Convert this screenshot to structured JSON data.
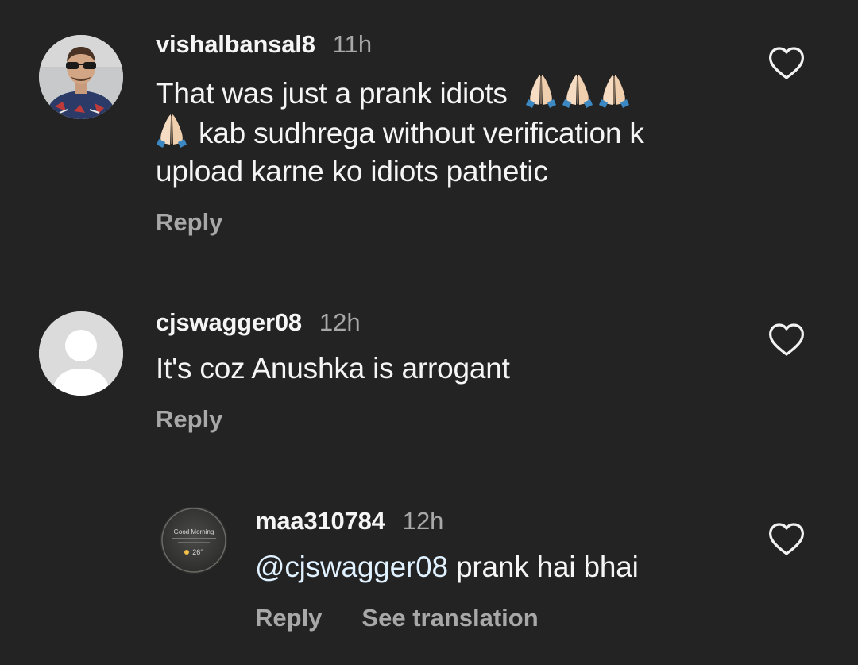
{
  "colors": {
    "background": "#232323",
    "primary_text": "#f5f5f5",
    "secondary_text": "#a8a8a8"
  },
  "comments": [
    {
      "username": "vishalbansal8",
      "time": "11h",
      "text_line1": "That was just a prank idiots",
      "text_line2": "kab sudhrega without verification k",
      "text_line3": "upload karne ko idiots pathetic",
      "emoji": "folded-hands",
      "reply_label": "Reply"
    },
    {
      "username": "cjswagger08",
      "time": "12h",
      "text": "It's coz Anushka is arrogant",
      "reply_label": "Reply"
    },
    {
      "username": "maa310784",
      "time": "12h",
      "mention": "@cjswagger08",
      "text": " prank hai bhai",
      "avatar_title": "Good Morning",
      "avatar_temp": "26°",
      "reply_label": "Reply",
      "translate_label": "See translation"
    }
  ],
  "icons": {
    "like": "heart-outline-icon",
    "emoji": "folded-hands-emoji"
  }
}
